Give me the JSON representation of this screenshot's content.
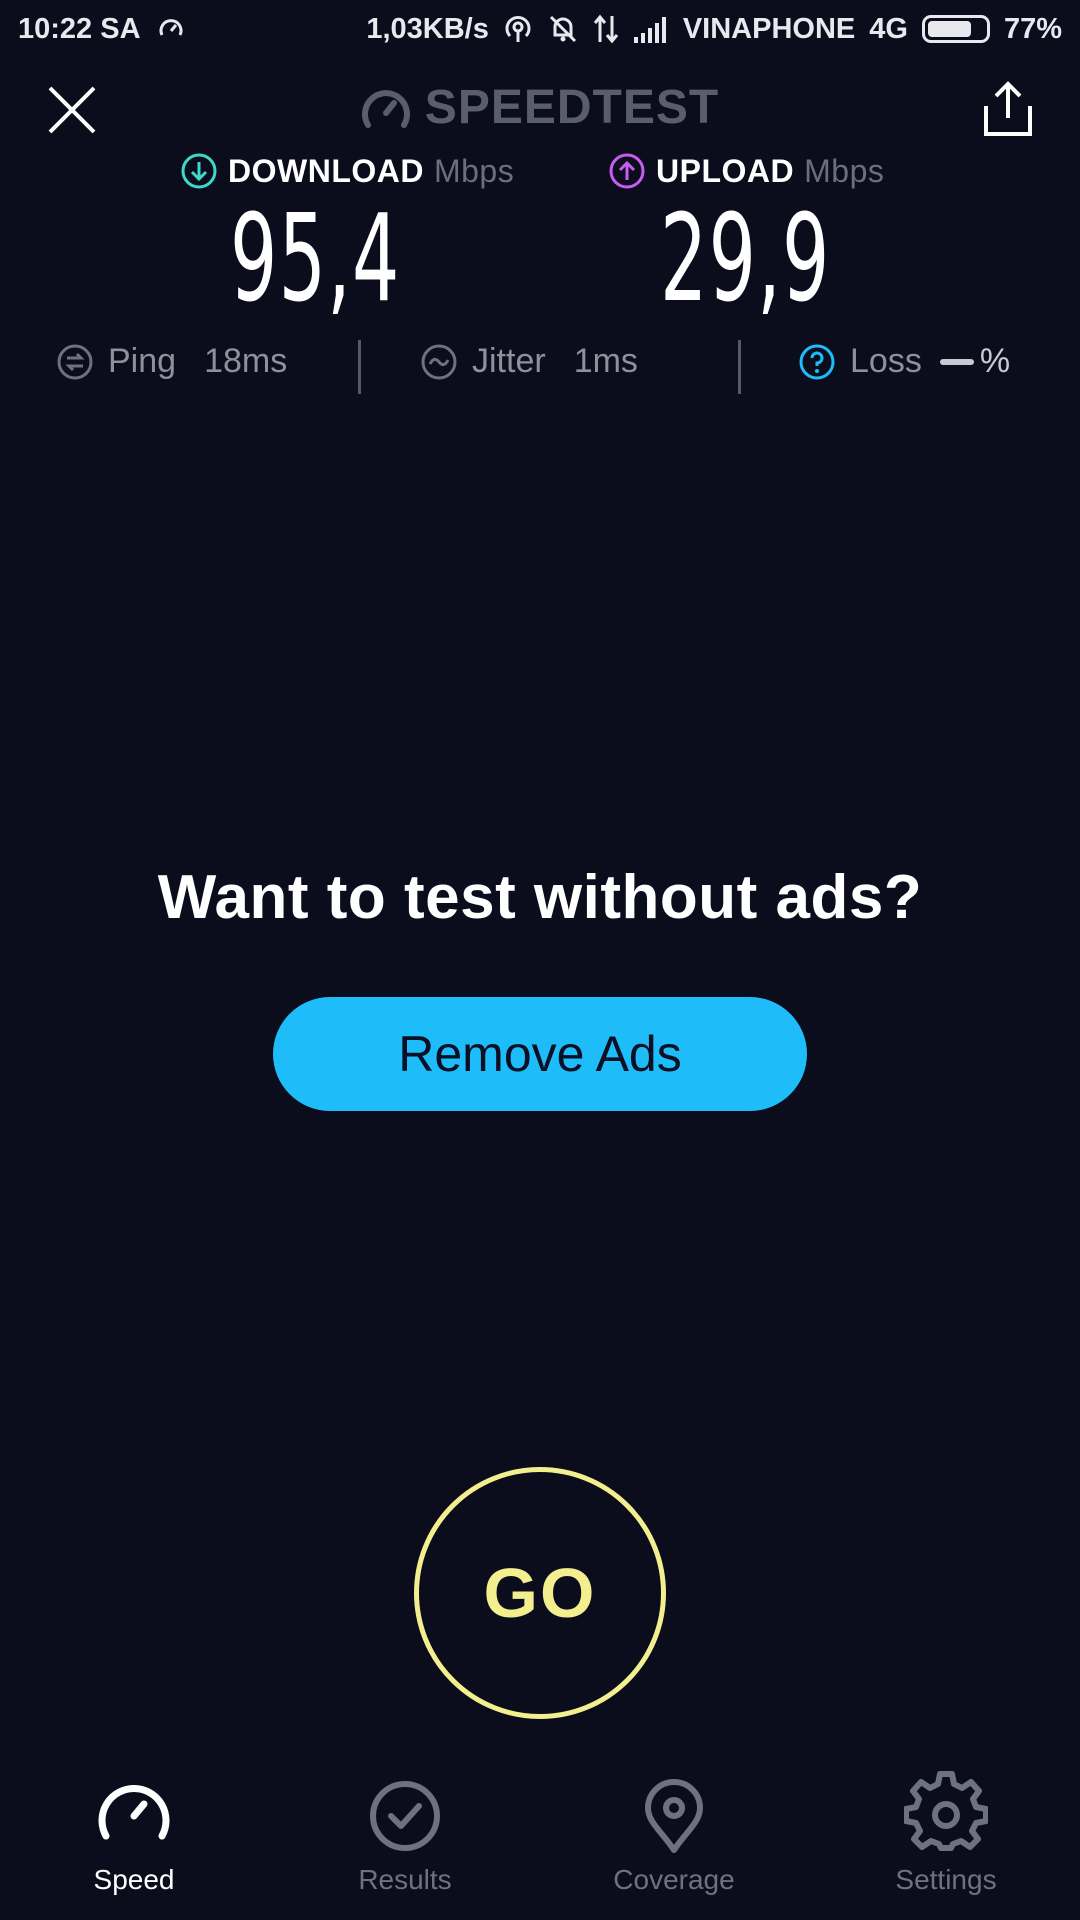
{
  "status_bar": {
    "time": "10:22 SA",
    "net_speed": "1,03KB/s",
    "carrier": "VINAPHONE",
    "network": "4G",
    "battery": "77%",
    "battery_level": 0.77
  },
  "header": {
    "title": "SPEEDTEST"
  },
  "download": {
    "label": "DOWNLOAD",
    "unit": "Mbps",
    "value": "95,4"
  },
  "upload": {
    "label": "UPLOAD",
    "unit": "Mbps",
    "value": "29,9"
  },
  "stats": {
    "ping": {
      "label": "Ping",
      "value": "18ms"
    },
    "jitter": {
      "label": "Jitter",
      "value": "1ms"
    },
    "loss": {
      "label": "Loss",
      "value": "%"
    }
  },
  "promo": {
    "title": "Want to test without ads?",
    "button": "Remove Ads"
  },
  "go_label": "GO",
  "nav": [
    {
      "label": "Speed",
      "icon": "speedometer-icon",
      "active": true
    },
    {
      "label": "Results",
      "icon": "check-circle-icon",
      "active": false
    },
    {
      "label": "Coverage",
      "icon": "map-pin-icon",
      "active": false
    },
    {
      "label": "Settings",
      "icon": "gear-icon",
      "active": false
    }
  ],
  "colors": {
    "background": "#0b0d1c",
    "download_accent": "#3fd8c9",
    "upload_accent": "#c65cf0",
    "button_blue": "#1ebcf9",
    "go_yellow": "#f4ef8e"
  }
}
